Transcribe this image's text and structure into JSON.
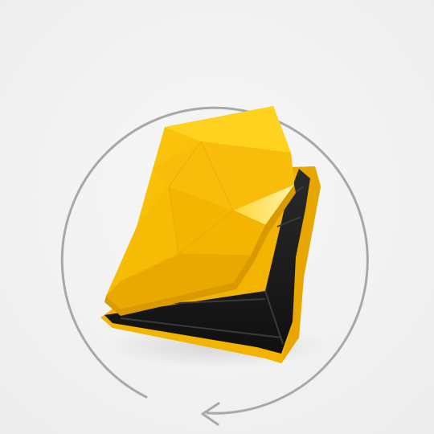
{
  "viewer": {
    "rotate_icon": "rotate-360-icon",
    "product": "yellow-folding-case",
    "colors": {
      "background": "#f2f2f2",
      "shell_yellow": "#f5b800",
      "shell_highlight": "#ffd633",
      "shell_shadow": "#d99a00",
      "inner_dark": "#1c1c1c",
      "arrow_gray": "#a8a8a8"
    }
  }
}
